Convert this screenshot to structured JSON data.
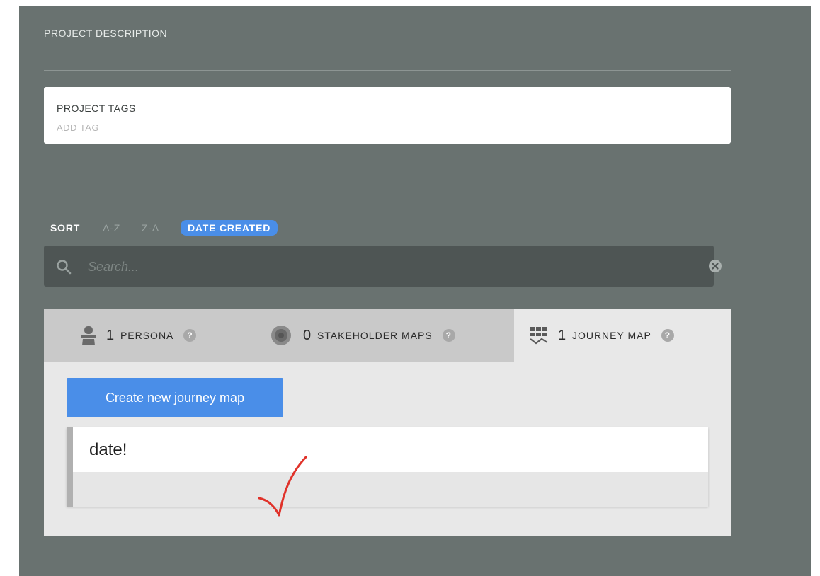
{
  "project": {
    "description_label": "PROJECT DESCRIPTION",
    "tags_title": "PROJECT TAGS",
    "tags_placeholder": "ADD TAG"
  },
  "sort": {
    "label": "SORT",
    "options": [
      "A-Z",
      "Z-A"
    ],
    "active": "DATE CREATED"
  },
  "search": {
    "placeholder": "Search...",
    "value": ""
  },
  "tabs": [
    {
      "count": "1",
      "label": "PERSONA",
      "icon": "persona-icon",
      "active": false
    },
    {
      "count": "0",
      "label": "STAKEHOLDER MAPS",
      "icon": "stakeholder-map-icon",
      "active": false
    },
    {
      "count": "1",
      "label": "JOURNEY MAP",
      "icon": "journey-map-icon",
      "active": true
    }
  ],
  "journey": {
    "create_label": "Create new journey map",
    "maps": [
      {
        "title": "date!"
      }
    ]
  },
  "colors": {
    "panel": "#697270",
    "accent": "#4a8ee8",
    "annotation": "#e0322a"
  }
}
